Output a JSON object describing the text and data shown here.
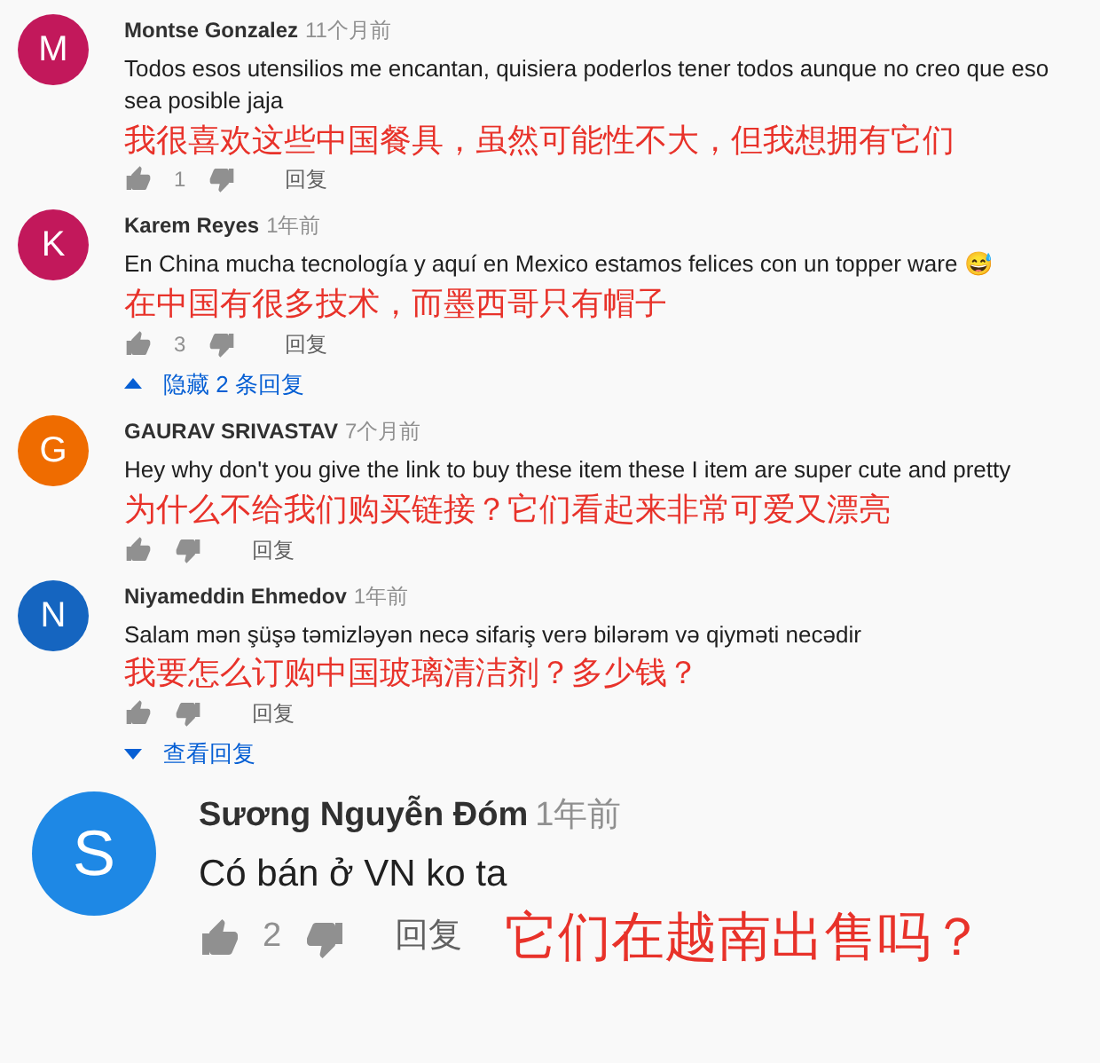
{
  "comments": [
    {
      "kind": "normal",
      "initial": "M",
      "color": "#c2185b",
      "author": "Montse Gonzalez",
      "time": "11个月前",
      "text": "Todos esos utensilios me encantan, quisiera poderlos tener todos aunque no creo que eso sea posible jaja",
      "caption": "我很喜欢这些中国餐具，虽然可能性不大，但我想拥有它们",
      "likes": "1",
      "reply": "回复"
    },
    {
      "kind": "normal",
      "initial": "K",
      "color": "#c2185b",
      "author": "Karem Reyes",
      "time": "1年前",
      "text": "En China mucha tecnología y aquí en Mexico estamos felices con un topper ware 😅",
      "caption": "在中国有很多技术，而墨西哥只有帽子",
      "likes": "3",
      "reply": "回复",
      "replies": {
        "label": "隐藏 2 条回复",
        "expanded": true
      }
    },
    {
      "kind": "normal",
      "initial": "G",
      "color": "#ef6c00",
      "author": "GAURAV SRIVASTAV",
      "time": "7个月前",
      "text": "Hey why don't you give the link to buy these item these I item are super cute and pretty",
      "caption": "为什么不给我们购买链接？它们看起来非常可爱又漂亮",
      "reply": "回复"
    },
    {
      "kind": "normal",
      "initial": "N",
      "color": "#1565c0",
      "author": "Niyameddin Ehmedov",
      "time": "1年前",
      "text": "Salam mən  şüşə təmizləyən necə  sifariş verə bilərəm və qiyməti necədir",
      "caption": "我要怎么订购中国玻璃清洁剂？多少钱？",
      "reply": "回复",
      "replies": {
        "label": "查看回复",
        "expanded": false
      }
    },
    {
      "kind": "large",
      "initial": "S",
      "color": "#1e88e5",
      "author": "Sương Nguyễn Đóm",
      "time": "1年前",
      "text": "Có bán ở VN ko ta",
      "caption": "它们在越南出售吗？",
      "likes": "2",
      "reply": "回复"
    }
  ]
}
